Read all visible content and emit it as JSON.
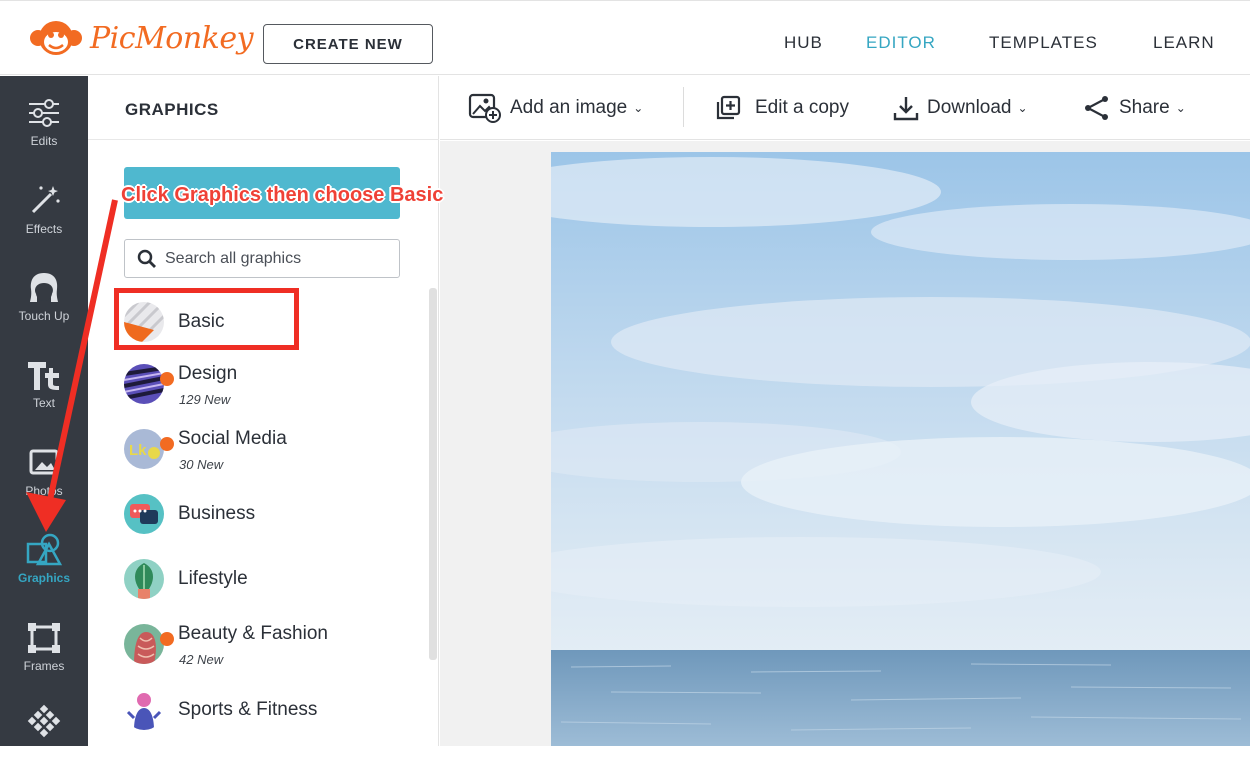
{
  "app": {
    "logo_text": "PicMonkey",
    "create_button": "CREATE NEW"
  },
  "topnav": [
    {
      "label": "HUB",
      "active": false
    },
    {
      "label": "EDITOR",
      "active": true
    },
    {
      "label": "TEMPLATES",
      "active": false
    },
    {
      "label": "LEARN",
      "active": false
    }
  ],
  "rail": [
    {
      "label": "Edits",
      "icon": "sliders-icon"
    },
    {
      "label": "Effects",
      "icon": "magic-wand-icon"
    },
    {
      "label": "Touch Up",
      "icon": "face-icon"
    },
    {
      "label": "Text",
      "icon": "text-icon"
    },
    {
      "label": "Photos",
      "icon": "photo-icon"
    },
    {
      "label": "Graphics",
      "icon": "graphics-icon",
      "active": true
    },
    {
      "label": "Frames",
      "icon": "frame-icon"
    },
    {
      "label": "",
      "icon": "pattern-icon"
    }
  ],
  "panel": {
    "title": "GRAPHICS",
    "search_placeholder": "Search all graphics",
    "categories": [
      {
        "name": "Basic",
        "sub": "",
        "new_dot": false
      },
      {
        "name": "Design",
        "sub": "129 New",
        "new_dot": true
      },
      {
        "name": "Social Media",
        "sub": "30 New",
        "new_dot": true
      },
      {
        "name": "Business",
        "sub": "",
        "new_dot": false
      },
      {
        "name": "Lifestyle",
        "sub": "",
        "new_dot": false
      },
      {
        "name": "Beauty & Fashion",
        "sub": "42 New",
        "new_dot": true
      },
      {
        "name": "Sports & Fitness",
        "sub": "",
        "new_dot": false
      }
    ]
  },
  "toolbar": {
    "add_image": "Add an image",
    "edit_copy": "Edit a copy",
    "download": "Download",
    "share": "Share"
  },
  "annotation": {
    "text": "Click Graphics then choose Basic"
  },
  "colors": {
    "accent": "#35a6c2",
    "brand": "#f26b22",
    "rail": "#353a42",
    "annotation": "#ef2e24"
  }
}
